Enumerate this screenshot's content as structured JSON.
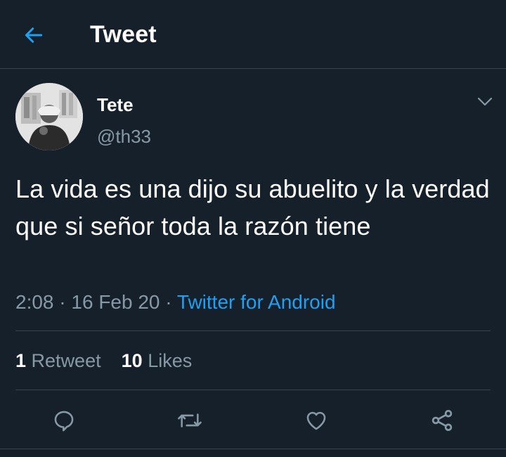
{
  "header": {
    "back_icon": "arrow-left-icon",
    "title": "Tweet"
  },
  "tweet": {
    "author": {
      "display_name": "Tete",
      "handle": "@th33"
    },
    "caret_icon": "chevron-down-icon",
    "text": "La vida es una dijo su abuelito y la verdad que si señor toda la razón tiene",
    "time": "2:08",
    "date": "16 Feb 20",
    "separator": "·",
    "source": "Twitter for Android"
  },
  "stats": {
    "retweets_count": "1",
    "retweets_label": "Retweet",
    "likes_count": "10",
    "likes_label": "Likes"
  },
  "actions": [
    {
      "icon": "reply-icon"
    },
    {
      "icon": "retweet-icon"
    },
    {
      "icon": "heart-icon"
    },
    {
      "icon": "share-icon"
    }
  ],
  "colors": {
    "background": "#15202b",
    "accent": "#1da1f2",
    "secondary_text": "#8899a6",
    "divider": "#38444d"
  }
}
